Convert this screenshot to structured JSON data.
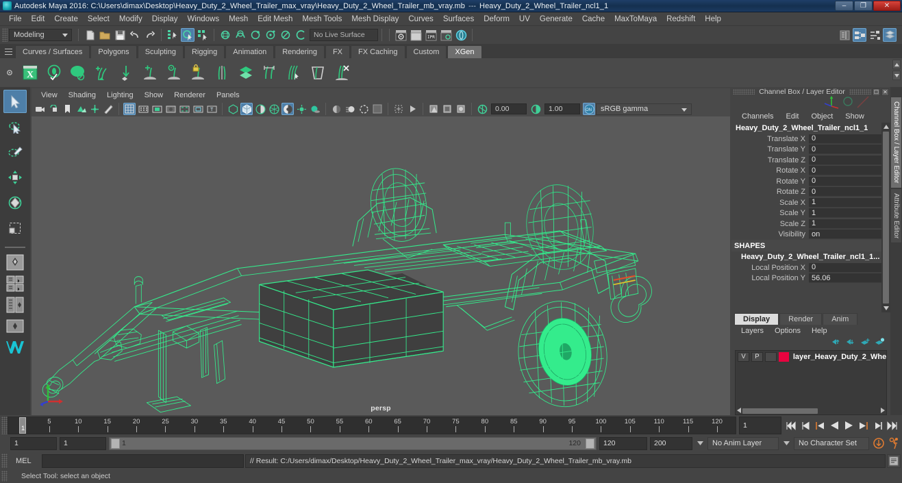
{
  "window": {
    "title": "Autodesk Maya 2016: C:\\Users\\dimax\\Desktop\\Heavy_Duty_2_Wheel_Trailer_max_vray\\Heavy_Duty_2_Wheel_Trailer_mb_vray.mb",
    "separator": "---",
    "selection_name": "Heavy_Duty_2_Wheel_Trailer_ncl1_1",
    "minimize": "–",
    "restore": "❐",
    "close": "✕",
    "titlebar_color": "#1b3a60"
  },
  "main_menu": [
    "File",
    "Edit",
    "Create",
    "Select",
    "Modify",
    "Display",
    "Windows",
    "Mesh",
    "Edit Mesh",
    "Mesh Tools",
    "Mesh Display",
    "Curves",
    "Surfaces",
    "Deform",
    "UV",
    "Generate",
    "Cache",
    "MaxToMaya",
    "Redshift",
    "Help"
  ],
  "status_line": {
    "menu_set": "Modeling",
    "live_surface": "No Live Surface",
    "icons": [
      "new-scene-icon",
      "open-scene-icon",
      "save-scene-icon",
      "undo-icon",
      "redo-icon",
      "select-by-hierarchy-icon",
      "select-by-object-type-icon",
      "select-by-component-type-icon",
      "snap-to-grid-icon",
      "snap-to-curve-icon",
      "snap-to-point-icon",
      "snap-to-projected-center-icon",
      "snap-to-view-plane-icon",
      "make-live-icon",
      "render-current-frame-icon",
      "ipr-render-icon",
      "render-settings-icon",
      "hypershade-icon",
      "render-view-icon",
      "outliner-icon",
      "node-editor-icon",
      "attribute-editor-icon",
      "tool-settings-icon"
    ]
  },
  "shelf": {
    "tabs": [
      "Curves / Surfaces",
      "Polygons",
      "Sculpting",
      "Rigging",
      "Animation",
      "Rendering",
      "FX",
      "FX Caching",
      "Custom",
      "XGen"
    ],
    "active_tab": "XGen",
    "buttons": [
      "xgen-editor-icon",
      "xgen-preview-icon",
      "xgen-sphere-icon",
      "xgen-add-groom-icon",
      "xgen-place-icon",
      "xgen-add-clump-icon",
      "xgen-noise-icon",
      "xgen-lock-icon",
      "xgen-part-icon",
      "xgen-layer-icon",
      "xgen-length-icon",
      "xgen-comb-icon",
      "xgen-cut-icon",
      "xgen-delete-icon"
    ]
  },
  "toolbox": {
    "tools": [
      "select-tool",
      "lasso-select-tool",
      "paint-select-tool",
      "move-tool",
      "rotate-tool",
      "scale-tool"
    ],
    "selected": "select-tool",
    "layout_buttons": [
      "single-perspective-layout",
      "four-view-layout",
      "outliner-persp-layout",
      "hypergraph-persp-layout",
      "maya-logo"
    ]
  },
  "viewport": {
    "menus": [
      "View",
      "Shading",
      "Lighting",
      "Show",
      "Renderer",
      "Panels"
    ],
    "camera_label": "persp",
    "exposure": "0.00",
    "gamma": "1.00",
    "color_management": "sRGB gamma",
    "background_color": "#5a5a5a",
    "wireframe_color": "#34ec8c",
    "toolbar_icons": [
      "select-camera-icon",
      "bookmark-icon",
      "image-plane-icon",
      "paint-effects-icon",
      "grid-icon",
      "film-gate-icon",
      "resolution-gate-icon",
      "gate-mask-icon",
      "film-origin-icon",
      "safe-action-icon",
      "safe-title-icon",
      "wireframe-icon",
      "smooth-shade-icon",
      "shaded-wireframe-icon",
      "use-default-material-icon",
      "textured-icon",
      "lighting-icon",
      "shadows-icon",
      "screen-space-ao-icon",
      "motion-blur-icon",
      "isolate-select-icon",
      "xray-icon",
      "xray-joints-icon",
      "exposure-icon",
      "gamma-icon",
      "color-management-icon"
    ]
  },
  "channel_box": {
    "panel_title": "Channel Box / Layer Editor",
    "menus": [
      "Channels",
      "Edit",
      "Object",
      "Show"
    ],
    "object_name": "Heavy_Duty_2_Wheel_Trailer_ncl1_1",
    "attributes": [
      {
        "label": "Translate X",
        "value": "0"
      },
      {
        "label": "Translate Y",
        "value": "0"
      },
      {
        "label": "Translate Z",
        "value": "0"
      },
      {
        "label": "Rotate X",
        "value": "0"
      },
      {
        "label": "Rotate Y",
        "value": "0"
      },
      {
        "label": "Rotate Z",
        "value": "0"
      },
      {
        "label": "Scale X",
        "value": "1"
      },
      {
        "label": "Scale Y",
        "value": "1"
      },
      {
        "label": "Scale Z",
        "value": "1"
      },
      {
        "label": "Visibility",
        "value": "on"
      }
    ],
    "shapes_header": "SHAPES",
    "shape_name": "Heavy_Duty_2_Wheel_Trailer_ncl1_1...",
    "shape_attributes": [
      {
        "label": "Local Position X",
        "value": "0"
      },
      {
        "label": "Local Position Y",
        "value": "56.06"
      }
    ]
  },
  "layer_editor": {
    "tabs": [
      "Display",
      "Render",
      "Anim"
    ],
    "active_tab": "Display",
    "menus": [
      "Layers",
      "Options",
      "Help"
    ],
    "tool_icons": [
      "move-layer-up-icon",
      "move-layer-down-icon",
      "new-layer-icon",
      "new-layer-from-selected-icon"
    ],
    "layers": [
      {
        "visibility": "V",
        "playback": "P",
        "type": "",
        "color": "#e8033f",
        "name": "layer_Heavy_Duty_2_Whe"
      }
    ]
  },
  "right_vertical_tabs": [
    {
      "label": "Channel Box / Layer Editor",
      "active": true
    },
    {
      "label": "Attribute Editor",
      "active": false
    }
  ],
  "timeline": {
    "ticks": [
      5,
      10,
      15,
      20,
      25,
      30,
      35,
      40,
      45,
      50,
      55,
      60,
      65,
      70,
      75,
      80,
      85,
      90,
      95,
      100,
      105,
      110,
      115,
      120
    ],
    "range_start": 1,
    "range_end": 120,
    "current_frame": "1",
    "playback_start": "1",
    "playback_end": "1",
    "range_bar_start": "1",
    "range_bar_end": "120",
    "anim_end": "120",
    "scene_end": "200",
    "anim_layer": "No Anim Layer",
    "character_set": "No Character Set",
    "playback_buttons": [
      "go-to-start-icon",
      "step-back-keyframe-icon",
      "step-back-frame-icon",
      "play-backwards-icon",
      "play-forwards-icon",
      "step-forward-frame-icon",
      "step-forward-keyframe-icon",
      "go-to-end-icon"
    ],
    "extra_buttons": [
      "auto-key-icon",
      "animation-preferences-icon"
    ]
  },
  "command_line": {
    "label": "MEL",
    "input_value": "",
    "result": "// Result: C:/Users/dimax/Desktop/Heavy_Duty_2_Wheel_Trailer_max_vray/Heavy_Duty_2_Wheel_Trailer_mb_vray.mb",
    "script_editor_icon": "script-editor-icon"
  },
  "help_line": {
    "text": "Select Tool: select an object"
  }
}
